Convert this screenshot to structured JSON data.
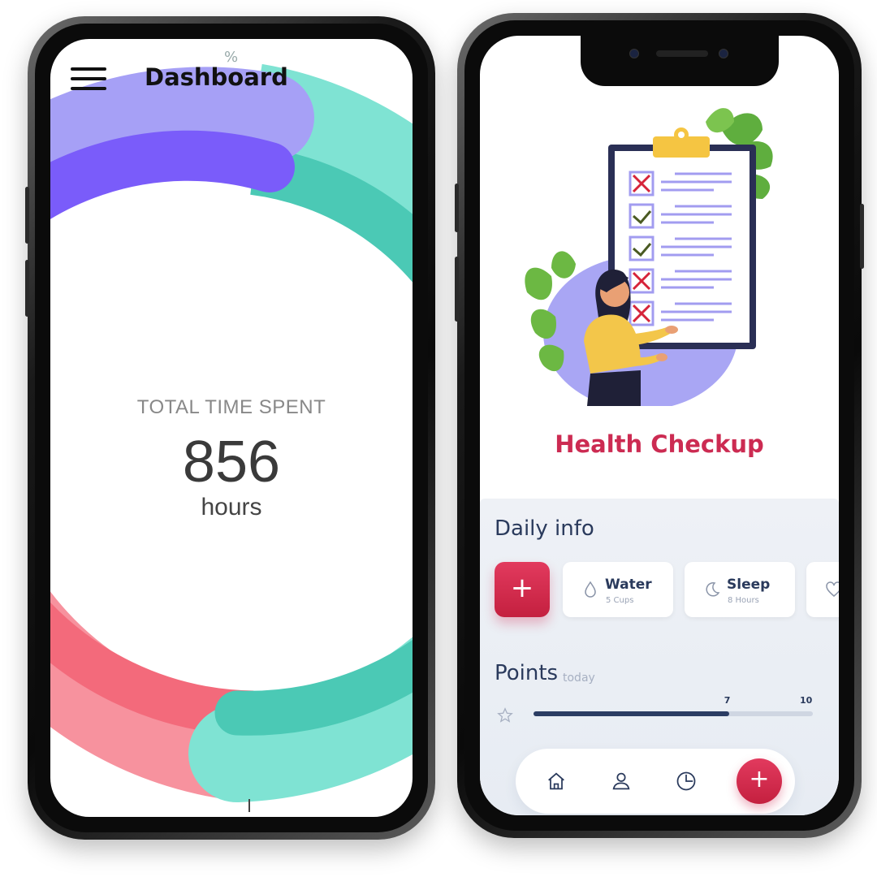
{
  "left_screen": {
    "header": {
      "title": "Dashboard",
      "marker": "%"
    },
    "stats": {
      "label": "TOTAL TIME SPENT",
      "value": "856",
      "unit": "hours"
    }
  },
  "right_screen": {
    "hero_title": "Health Checkup",
    "daily": {
      "title": "Daily info",
      "cards": [
        {
          "label": "Water",
          "sub": "5 Cups",
          "icon": "drop-icon"
        },
        {
          "label": "Sleep",
          "sub": "8 Hours",
          "icon": "moon-icon"
        }
      ]
    },
    "points": {
      "title": "Points",
      "period": "today",
      "current": 7,
      "max": 10,
      "current_label": "7",
      "max_label": "10"
    },
    "bottom_nav": [
      "home-icon",
      "user-icon",
      "clock-icon",
      "plus-icon"
    ]
  },
  "colors": {
    "accent": "#cc2b52",
    "navy": "#2a3a5c",
    "purple": "#7b63f6",
    "teal": "#4fcfb8",
    "coral": "#f26b7a"
  }
}
